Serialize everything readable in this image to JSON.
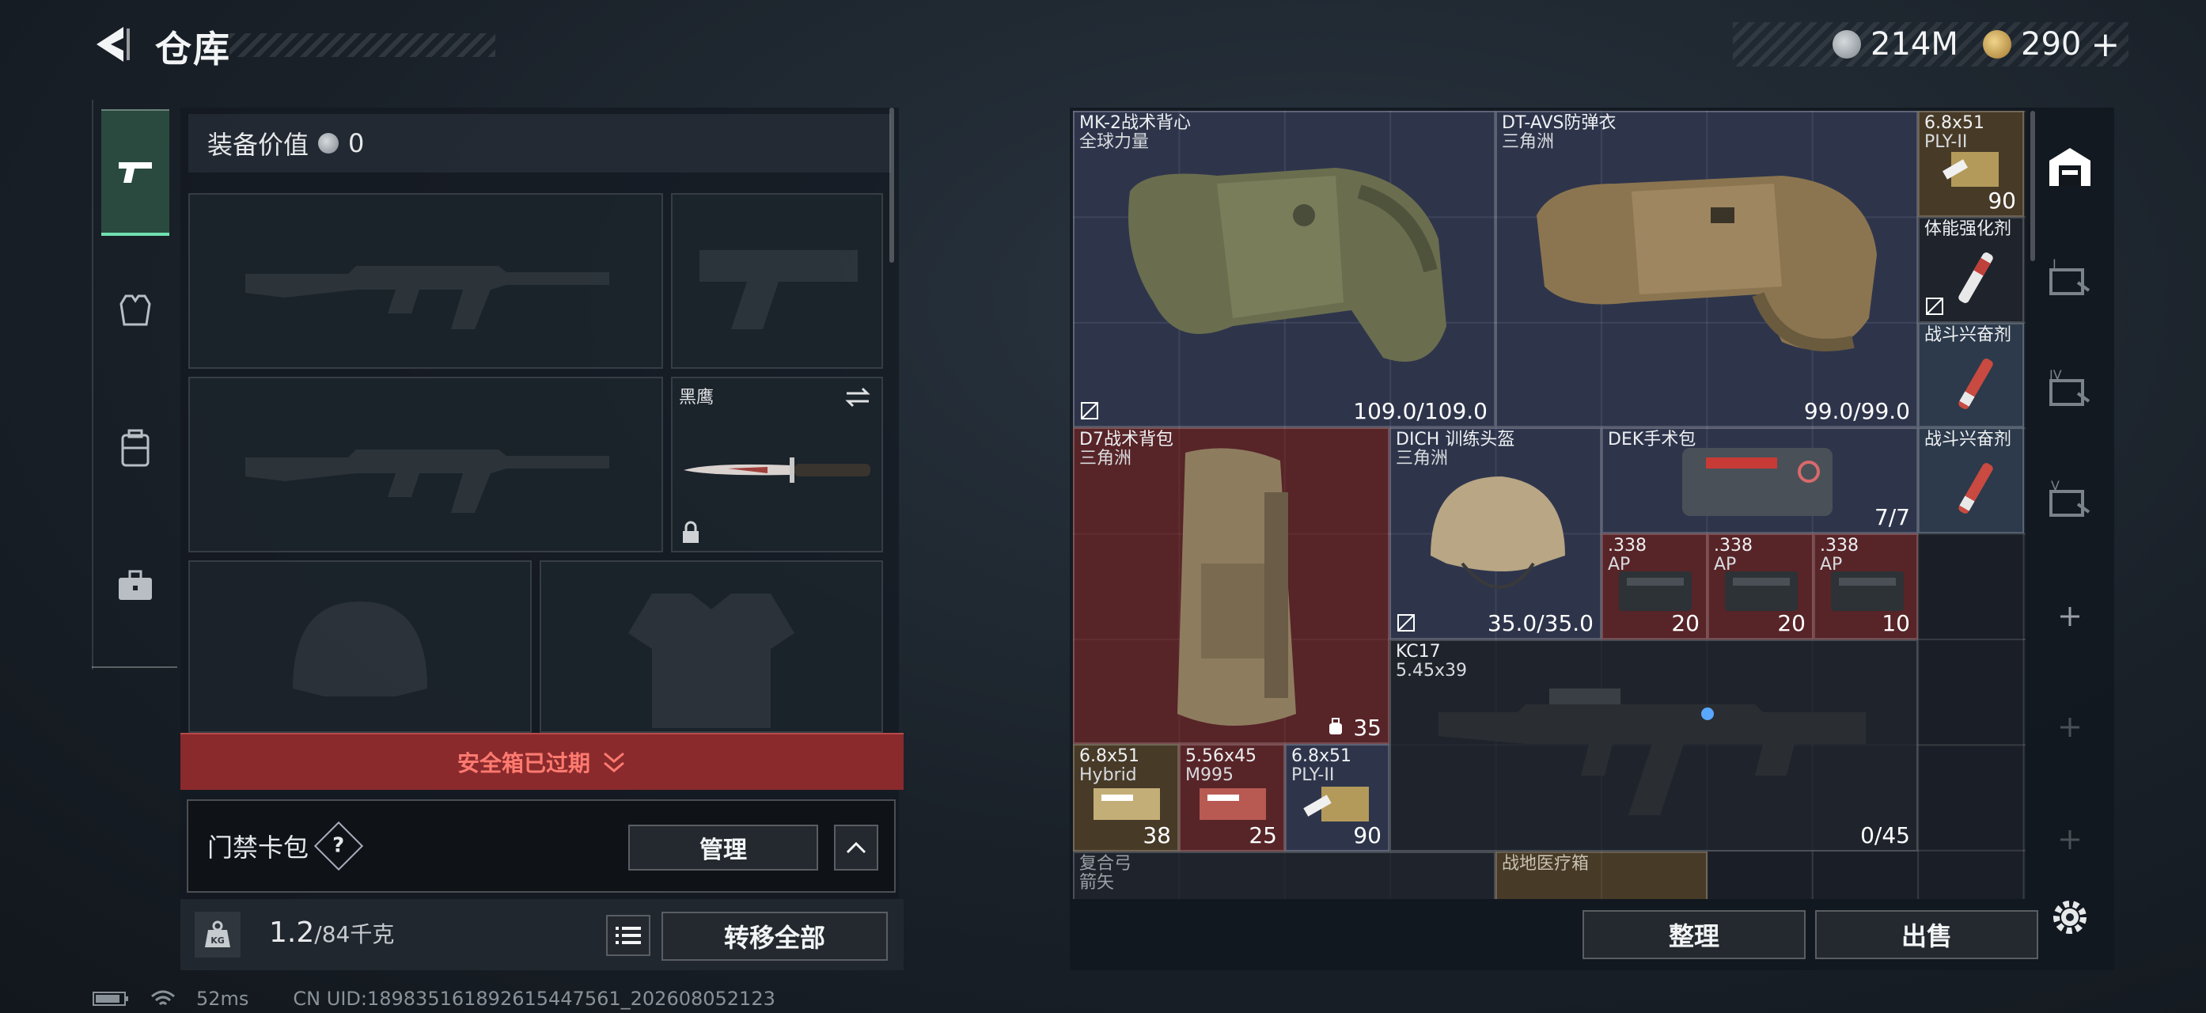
{
  "header": {
    "title": "仓库",
    "currency_silver": "214M",
    "currency_gold": "290",
    "gold_plus": "+"
  },
  "left_panel": {
    "equip_value_label": "装备价值",
    "equip_value": "0",
    "melee_slot_label": "黑鹰",
    "safe_box_text": "安全箱已过期",
    "keycard_label": "门禁卡包",
    "keycard_help": "?",
    "manage_button": "管理",
    "weight_current": "1.2",
    "weight_max": "/84千克",
    "transfer_all_button": "转移全部"
  },
  "inventory": {
    "items": [
      {
        "name": "MK-2战术背心",
        "sub": "全球力量",
        "count": "109.0/109.0"
      },
      {
        "name": "DT-AVS防弹衣",
        "sub": "三角洲",
        "count": "99.0/99.0"
      },
      {
        "name": "6.8x51",
        "sub": "PLY-II",
        "count": "90"
      },
      {
        "name": "体能强化剂",
        "sub": "",
        "count": ""
      },
      {
        "name": "战斗兴奋剂",
        "sub": "",
        "count": ""
      },
      {
        "name": "D7战术背包",
        "sub": "三角洲",
        "count": "35"
      },
      {
        "name": "DICH 训练头盔",
        "sub": "三角洲",
        "count": "35.0/35.0"
      },
      {
        "name": "DEK手术包",
        "sub": "",
        "count": "7/7"
      },
      {
        "name": "战斗兴奋剂",
        "sub": "",
        "count": ""
      },
      {
        "name": ".338",
        "sub": "AP",
        "count": "20"
      },
      {
        "name": ".338",
        "sub": "AP",
        "count": "20"
      },
      {
        "name": ".338",
        "sub": "AP",
        "count": "10"
      },
      {
        "name": "KC17",
        "sub": "5.45x39",
        "count": "0/45"
      },
      {
        "name": "6.8x51",
        "sub": "Hybrid",
        "count": "38"
      },
      {
        "name": "5.56x45",
        "sub": "M995",
        "count": "25"
      },
      {
        "name": "6.8x51",
        "sub": "PLY-II",
        "count": "90"
      },
      {
        "name": "复合弓",
        "sub": "箭矢",
        "count": ""
      },
      {
        "name": "战地医疗箱",
        "sub": "",
        "count": ""
      }
    ],
    "sort_button": "整理",
    "sell_button": "出售"
  },
  "right_tabs": [
    "I",
    "II",
    "IV",
    "V"
  ],
  "status": {
    "ping": "52ms",
    "uid": "CN UID:18983516189261544​7561_202608052123"
  },
  "colors": {
    "accent_green": "#6fe0b0",
    "danger_red": "#8a2a2c",
    "danger_text": "#ff7a70"
  }
}
